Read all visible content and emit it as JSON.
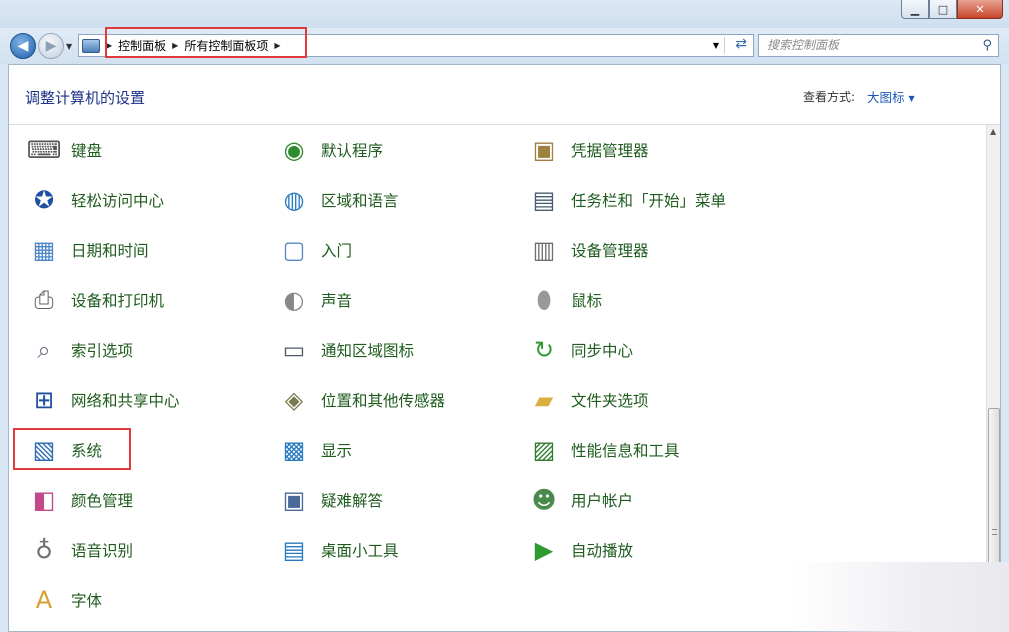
{
  "window": {
    "min_label": "▁",
    "max_label": "□",
    "close_label": "✕"
  },
  "nav": {
    "back_icon": "back-arrow-icon",
    "forward_icon": "forward-arrow-icon",
    "breadcrumb": [
      "控制面板",
      "所有控制面板项"
    ],
    "search_placeholder": "搜索控制面板"
  },
  "header": {
    "title": "调整计算机的设置",
    "view_by_label": "查看方式:",
    "view_by_value": "大图标"
  },
  "items": [
    {
      "label": "键盘",
      "icon": "keyboard-icon",
      "glyph": "⌨",
      "color": "#555555"
    },
    {
      "label": "默认程序",
      "icon": "default-programs-icon",
      "glyph": "◉",
      "color": "#2e8b2e"
    },
    {
      "label": "凭据管理器",
      "icon": "credential-manager-icon",
      "glyph": "▣",
      "color": "#a08040"
    },
    {
      "label": "轻松访问中心",
      "icon": "ease-of-access-icon",
      "glyph": "✪",
      "color": "#1f4fa0"
    },
    {
      "label": "区域和语言",
      "icon": "region-language-icon",
      "glyph": "◍",
      "color": "#2a7ac0"
    },
    {
      "label": "任务栏和「开始」菜单",
      "icon": "taskbar-icon",
      "glyph": "▤",
      "color": "#4a5a70"
    },
    {
      "label": "日期和时间",
      "icon": "date-time-icon",
      "glyph": "▦",
      "color": "#4a86c8"
    },
    {
      "label": "入门",
      "icon": "getting-started-icon",
      "glyph": "▢",
      "color": "#5a8ac0"
    },
    {
      "label": "设备管理器",
      "icon": "device-manager-icon",
      "glyph": "▥",
      "color": "#707070"
    },
    {
      "label": "设备和打印机",
      "icon": "devices-printers-icon",
      "glyph": "⎙",
      "color": "#606060"
    },
    {
      "label": "声音",
      "icon": "sound-icon",
      "glyph": "◐",
      "color": "#888888"
    },
    {
      "label": "鼠标",
      "icon": "mouse-icon",
      "glyph": "⬮",
      "color": "#999999"
    },
    {
      "label": "索引选项",
      "icon": "indexing-options-icon",
      "glyph": "⌕",
      "color": "#707a88"
    },
    {
      "label": "通知区域图标",
      "icon": "notification-area-icon",
      "glyph": "▭",
      "color": "#505a66"
    },
    {
      "label": "同步中心",
      "icon": "sync-center-icon",
      "glyph": "↻",
      "color": "#2f9a2f"
    },
    {
      "label": "网络和共享中心",
      "icon": "network-sharing-icon",
      "glyph": "⊞",
      "color": "#1f4fa0"
    },
    {
      "label": "位置和其他传感器",
      "icon": "location-sensors-icon",
      "glyph": "◈",
      "color": "#7a7a50"
    },
    {
      "label": "文件夹选项",
      "icon": "folder-options-icon",
      "glyph": "▰",
      "color": "#d8b040"
    },
    {
      "label": "系统",
      "icon": "system-icon",
      "glyph": "▧",
      "color": "#2a6ab0"
    },
    {
      "label": "显示",
      "icon": "display-icon",
      "glyph": "▩",
      "color": "#2a7ac0"
    },
    {
      "label": "性能信息和工具",
      "icon": "performance-icon",
      "glyph": "▨",
      "color": "#2f7a2f"
    },
    {
      "label": "颜色管理",
      "icon": "color-management-icon",
      "glyph": "◧",
      "color": "#c04a8a"
    },
    {
      "label": "疑难解答",
      "icon": "troubleshooting-icon",
      "glyph": "▣",
      "color": "#4a6a9a"
    },
    {
      "label": "用户帐户",
      "icon": "user-accounts-icon",
      "glyph": "☻",
      "color": "#4a8a4a"
    },
    {
      "label": "语音识别",
      "icon": "speech-recognition-icon",
      "glyph": "♁",
      "color": "#707070"
    },
    {
      "label": "桌面小工具",
      "icon": "desktop-gadgets-icon",
      "glyph": "▤",
      "color": "#2a7ac0"
    },
    {
      "label": "自动播放",
      "icon": "autoplay-icon",
      "glyph": "▶",
      "color": "#2f9a2f"
    },
    {
      "label": "字体",
      "icon": "fonts-icon",
      "glyph": "A",
      "color": "#d8a030"
    }
  ],
  "colors": {
    "highlight_box": "#e03a3a",
    "title_text": "#1e3287",
    "item_text": "#1e5c1e",
    "link_blue": "#1e57b5"
  }
}
